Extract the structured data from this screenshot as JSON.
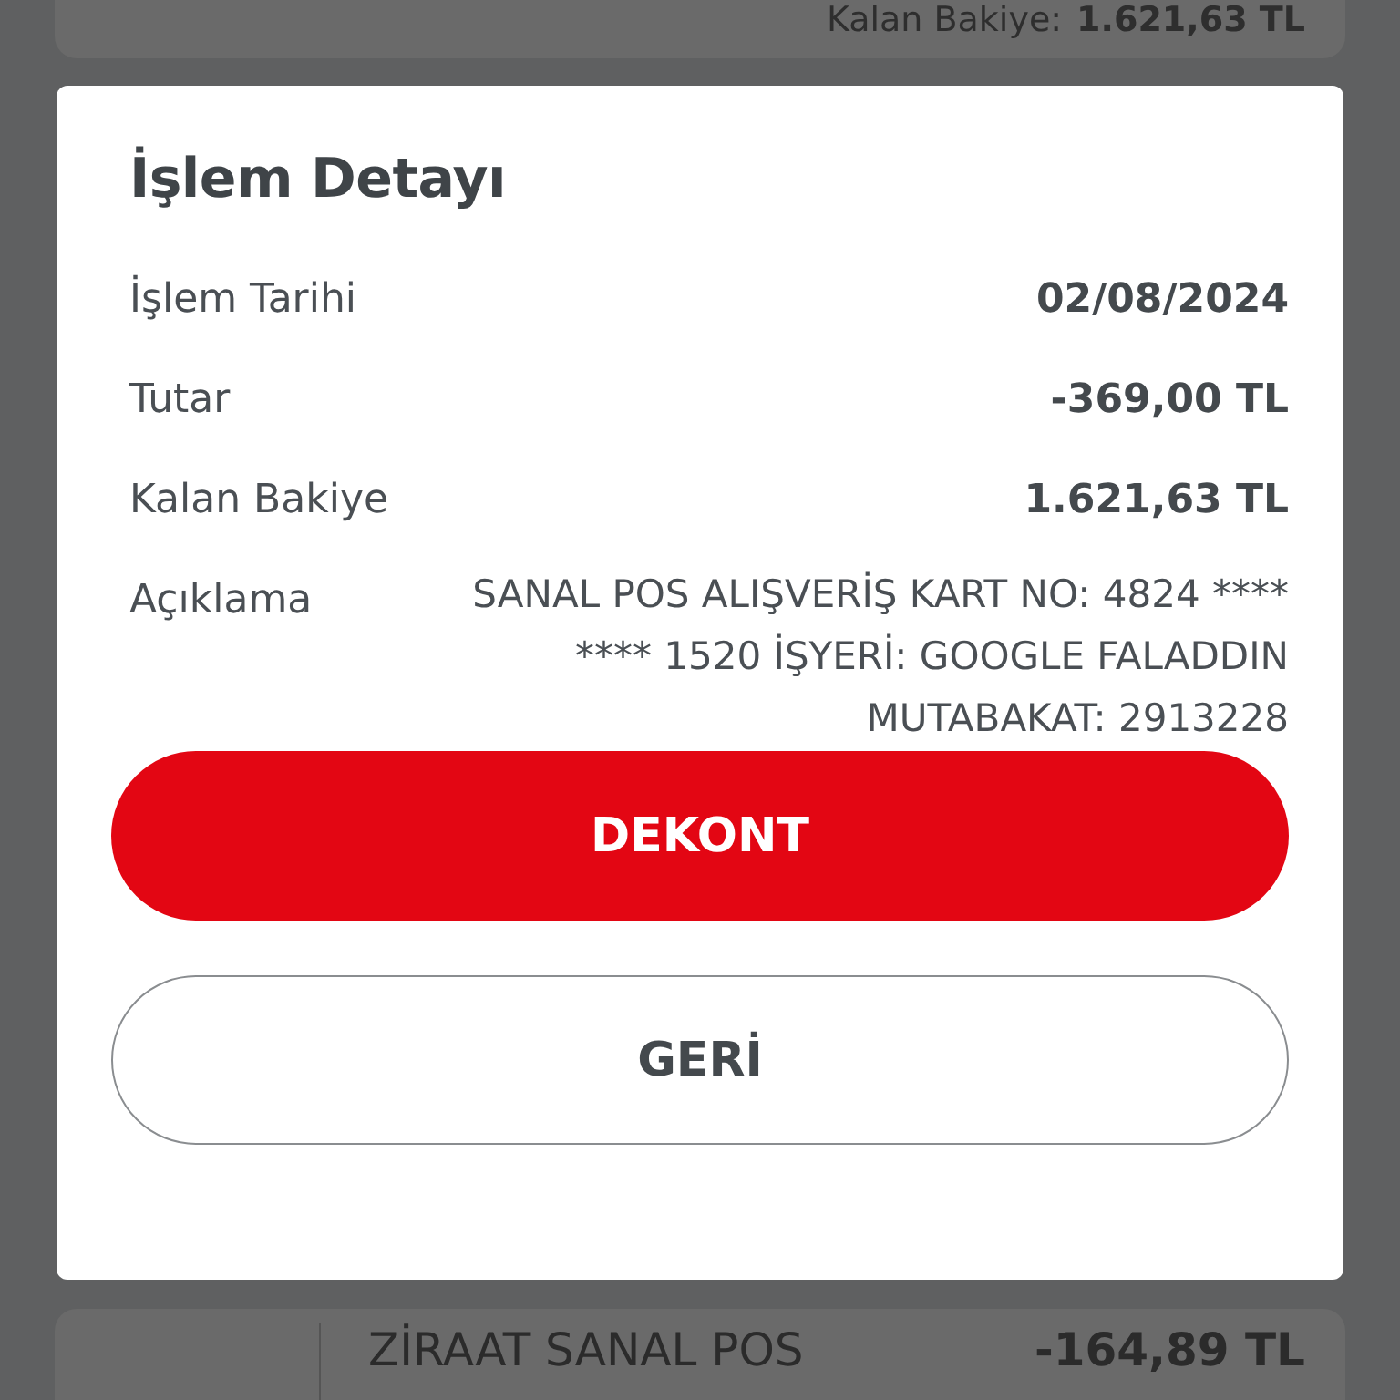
{
  "background_top_card": {
    "label": "Kalan Bakiye:",
    "value": "1.621,63 TL"
  },
  "dialog": {
    "title": "İşlem Detayı",
    "rows": [
      {
        "label": "İşlem Tarihi",
        "value": "02/08/2024"
      },
      {
        "label": "Tutar",
        "value": "-369,00 TL"
      },
      {
        "label": "Kalan Bakiye",
        "value": "1.621,63 TL"
      }
    ],
    "description": {
      "label": "Açıklama",
      "value": "SANAL POS ALIŞVERİŞ KART NO: 4824 **** **** 1520 İŞYERİ: GOOGLE FALADDIN MUTABAKAT: 2913228"
    },
    "buttons": [
      {
        "label": "DEKONT",
        "kind": "primary"
      },
      {
        "label": "GERİ",
        "kind": "secondary"
      }
    ]
  },
  "background_bottom_card": {
    "description": "ZİRAAT SANAL POS",
    "amount": "-164,89 TL"
  }
}
